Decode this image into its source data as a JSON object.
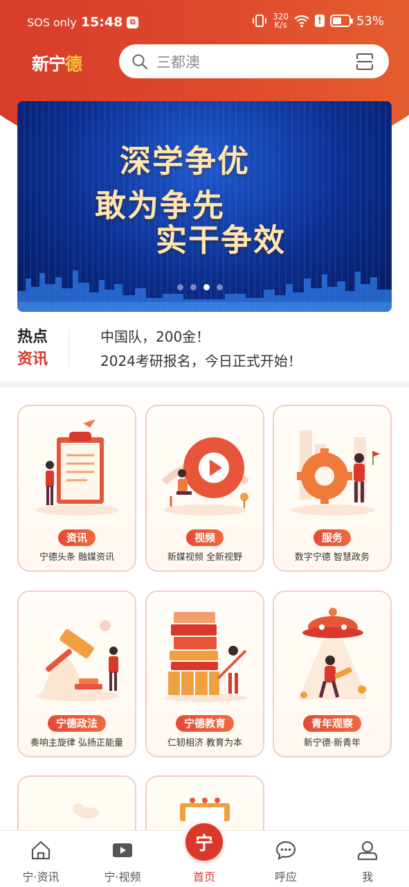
{
  "status_bar": {
    "carrier": "SOS only",
    "time": "15:48",
    "net_speed_value": "320",
    "net_speed_unit": "K/s",
    "battery": "53%",
    "battery_level": 0.53
  },
  "header": {
    "logo_main": "新宁",
    "logo_accent": "德",
    "search_placeholder": "三都澳"
  },
  "banner": {
    "lines": [
      "深学争优",
      "敢为争先",
      "实干争效"
    ],
    "slide_count": 4,
    "active_slide": 3
  },
  "hot_news": {
    "title_top": "热点",
    "title_bottom": "资讯",
    "items": [
      "中国队，200金！",
      "2024考研报名，今日正式开始！"
    ]
  },
  "cards": [
    {
      "tag": "资讯",
      "subtitle": "宁德头条  融媒资讯",
      "icon": "clipboard-icon"
    },
    {
      "tag": "视频",
      "subtitle": "新媒视频  全新视野",
      "icon": "play-icon"
    },
    {
      "tag": "服务",
      "subtitle": "数字宁德  智慧政务",
      "icon": "gear-icon"
    },
    {
      "tag": "宁德政法",
      "subtitle": "奏响主旋律 弘扬正能量",
      "icon": "gavel-icon"
    },
    {
      "tag": "宁德教育",
      "subtitle": "仁轫相济  教育为本",
      "icon": "books-icon"
    },
    {
      "tag": "青年观察",
      "subtitle": "新宁德·新青年",
      "icon": "ufo-icon"
    }
  ],
  "bottom_nav": {
    "items": [
      {
        "label": "宁·资讯",
        "icon": "home-outline-icon"
      },
      {
        "label": "宁·视频",
        "icon": "video-icon"
      },
      {
        "label": "首页",
        "icon": "home-badge-icon",
        "badge_char": "宁"
      },
      {
        "label": "呼应",
        "icon": "chat-icon"
      },
      {
        "label": "我",
        "icon": "user-icon"
      }
    ],
    "active_index": 2
  },
  "colors": {
    "brand_red": "#d8392a",
    "accent_orange": "#e6622e",
    "card_border": "#f2cdc4",
    "banner_blue": "#0b2d8d"
  }
}
